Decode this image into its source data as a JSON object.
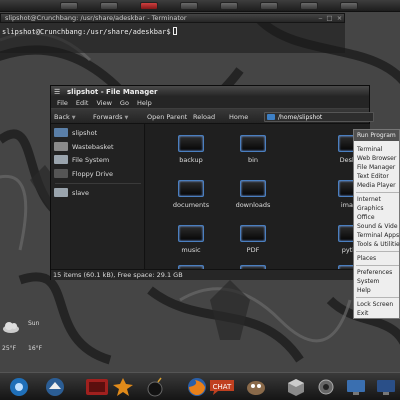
{
  "terminal": {
    "title": "slipshot@Crunchbang: /usr/share/adeskbar - Terminator",
    "prompt": "slipshot@Crunchbang:/usr/share/adeskbar$"
  },
  "file_manager": {
    "title": "slipshot - File Manager",
    "menu": [
      "File",
      "Edit",
      "View",
      "Go",
      "Help"
    ],
    "toolbar": {
      "back": "Back",
      "forwards": "Forwards",
      "open_parent": "Open Parent",
      "reload": "Reload",
      "home": "Home"
    },
    "location": "/home/slipshot",
    "sidebar": [
      {
        "label": "slipshot",
        "icon": "home-folder-icon"
      },
      {
        "label": "Wastebasket",
        "icon": "trash-icon"
      },
      {
        "label": "File System",
        "icon": "drive-icon"
      },
      {
        "label": "Floppy Drive",
        "icon": "floppy-icon"
      },
      {
        "label": "slave",
        "icon": "drive-icon"
      }
    ],
    "folders": [
      "backup",
      "bin",
      "Deskto",
      "documents",
      "downloads",
      "image",
      "music",
      "PDF",
      "pytho",
      "",
      "",
      ""
    ],
    "status": "15 items (60.1 kB), Free space: 29.1 GB"
  },
  "root_menu": {
    "title": "Run Program",
    "items": [
      "Terminal",
      "Web Browser",
      "File Manager",
      "Text Editor",
      "Media Player",
      "Internet",
      "Graphics",
      "Office",
      "Sound & Vide",
      "Terminal Apps",
      "Tools & Utilitie",
      "Places",
      "Preferences",
      "System",
      "Help",
      "Lock Screen",
      "Exit"
    ]
  },
  "weather": {
    "day": "Sun",
    "temp_high": "25°F",
    "temp_low": "16°F"
  },
  "dock": {
    "items": [
      "crunchbang-icon",
      "file-manager-icon",
      "terminal-icon",
      "burst-icon",
      "bomb-icon",
      "firefox-icon",
      "chat-icon",
      "gimp-icon",
      "cube-icon",
      "settings-icon",
      "screen-icon"
    ]
  },
  "colors": {
    "accent_blue": "#4a7fc0",
    "panel_dark": "#1e1e1e",
    "menu_bg": "#eeeeee"
  }
}
